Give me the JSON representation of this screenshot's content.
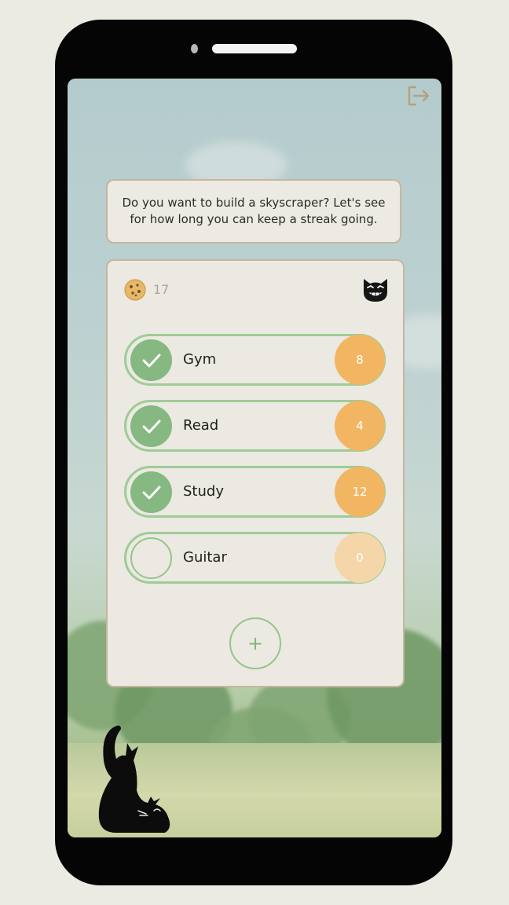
{
  "intro": {
    "text": "Do you want to build a skyscraper? Let's see for how long you can keep a streak going."
  },
  "header": {
    "cookie_icon": "cookie-icon",
    "cookie_count": "17",
    "cat_icon": "grinning-cat-emoji"
  },
  "habits": [
    {
      "name": "Gym",
      "streak": "8",
      "done": true
    },
    {
      "name": "Read",
      "streak": "4",
      "done": true
    },
    {
      "name": "Study",
      "streak": "12",
      "done": true
    },
    {
      "name": "Guitar",
      "streak": "0",
      "done": false
    }
  ],
  "add_button": {
    "label": "+"
  },
  "colors": {
    "accent_green": "#86b881",
    "streak_orange": "#f2b662",
    "streak_orange_inactive": "#f4d6a8",
    "card_border": "#c4b79e"
  }
}
